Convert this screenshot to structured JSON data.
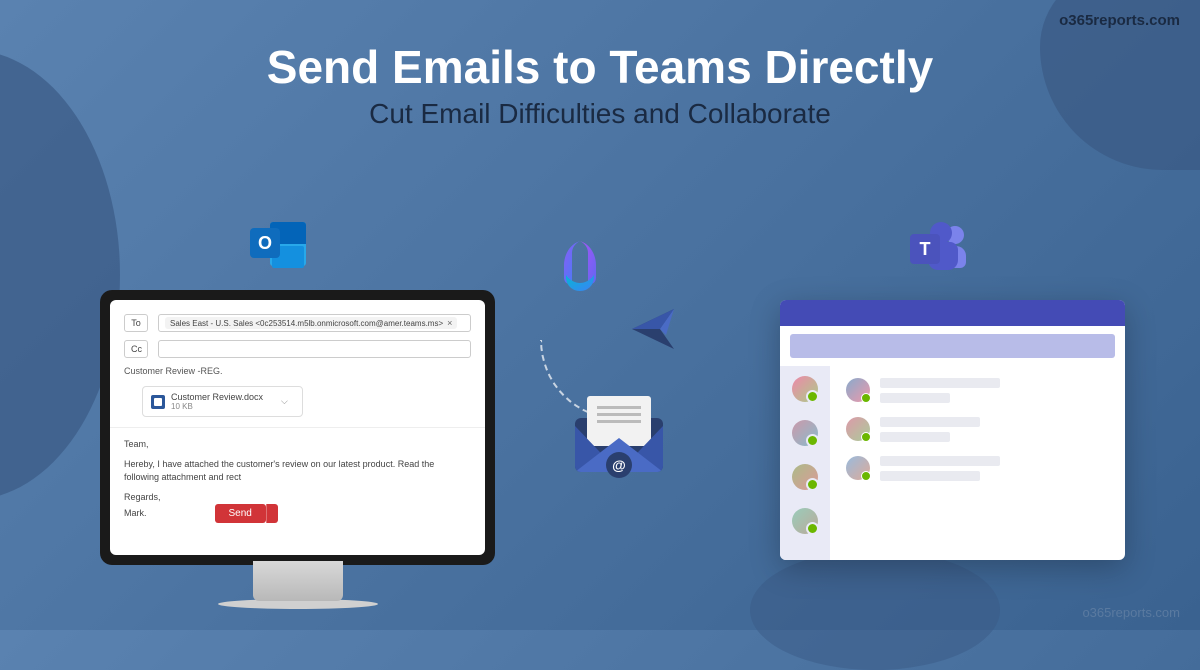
{
  "brand": "o365reports.com",
  "hero": {
    "title": "Send Emails to Teams Directly",
    "subtitle": "Cut Email Difficulties and Collaborate"
  },
  "icons": {
    "outlook_letter": "O",
    "teams_letter": "T",
    "at_symbol": "@"
  },
  "compose": {
    "to_label": "To",
    "cc_label": "Cc",
    "recipient": "Sales East - U.S. Sales <0c253514.m5lb.onmicrosoft.com@amer.teams.ms>",
    "subject": "Customer Review -REG.",
    "attachment": {
      "name": "Customer Review.docx",
      "size": "10 KB"
    },
    "greeting": "Team,",
    "body": "Hereby, I have attached the customer's review on our latest product. Read the following attachment and rect",
    "signoff": "Regards,",
    "signer": "Mark.",
    "send_label": "Send"
  }
}
